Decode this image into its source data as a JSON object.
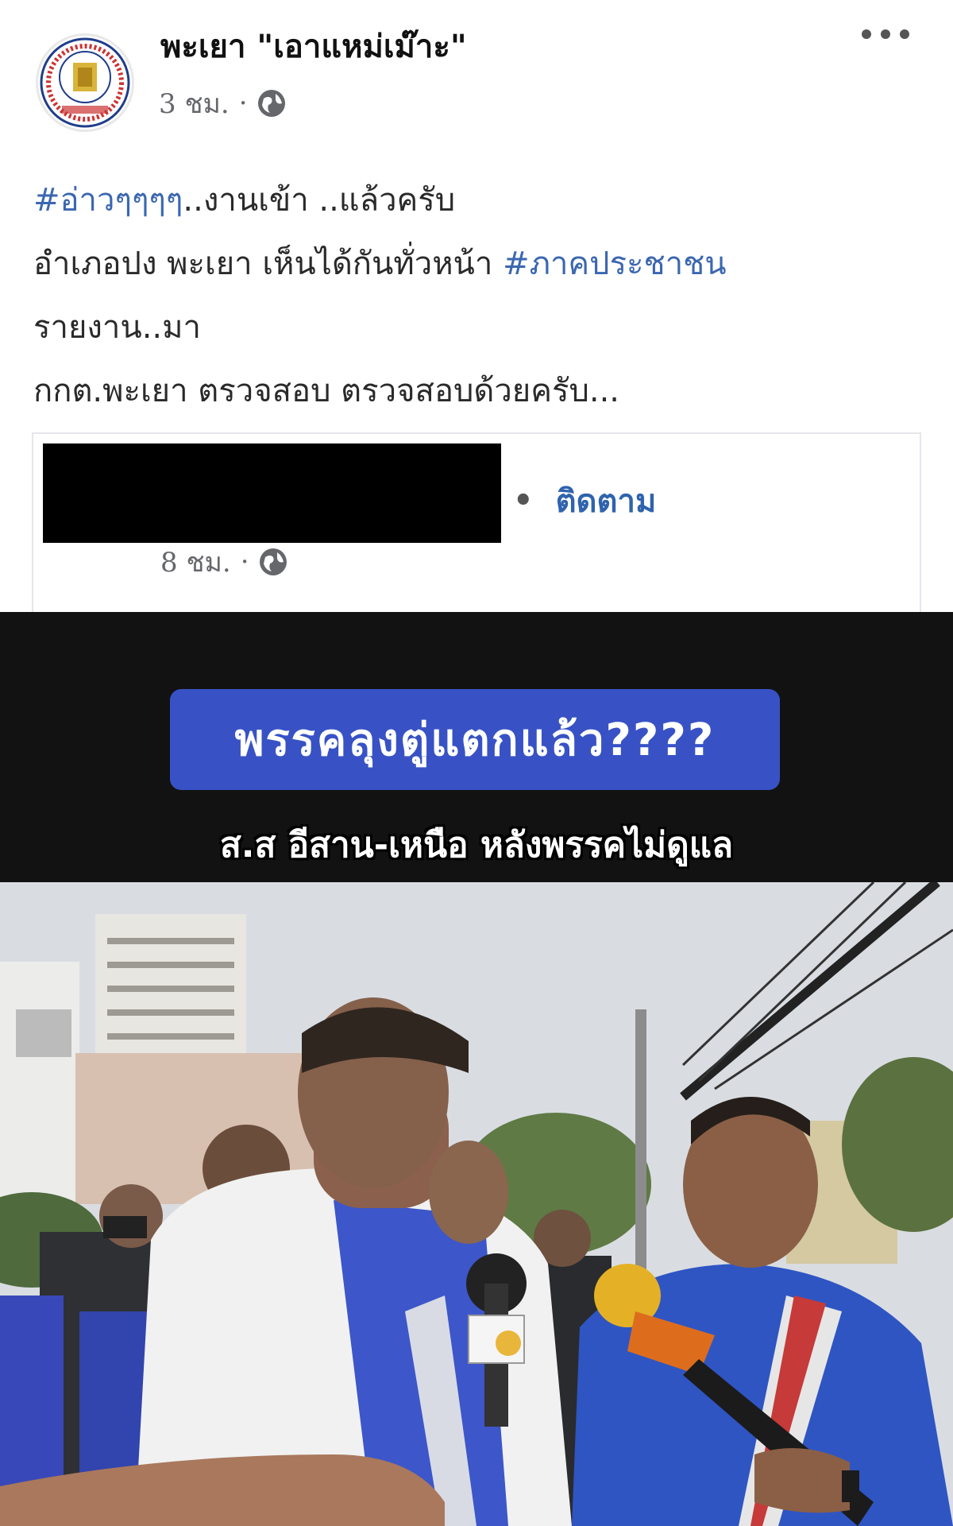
{
  "post": {
    "page_name": "พะเยา \"เอาแหม่เม๊าะ\"",
    "time": "3 ชม.",
    "dot": "·",
    "lines": [
      {
        "hashtag": "#อ่าวๆๆๆๆ",
        "text": "..งานเข้า ..แล้วครับ"
      },
      {
        "text": "อำเภอปง พะเยา เห็นได้กันทั่วหน้า ",
        "hashtag": "#ภาคประชาชน"
      },
      {
        "text": "รายงาน..มา"
      },
      {
        "text": "กกต.พะเยา ตรวจสอบ ตรวจสอบด้วยครับ..."
      }
    ]
  },
  "shared": {
    "dot": "•",
    "follow_label": "ติดตาม",
    "time": "8 ชม.",
    "dot2": "·"
  },
  "video": {
    "headline": "พรรคลุงตู่แตกแล้ว????",
    "subline": "ส.ส อีสาน-เหนือ หลังพรรคไม่ดูแล"
  },
  "colors": {
    "hashtag": "#3b67b0",
    "follow": "#2f63ad",
    "headline_bg": "#3852c5",
    "video_bg": "#121212"
  }
}
